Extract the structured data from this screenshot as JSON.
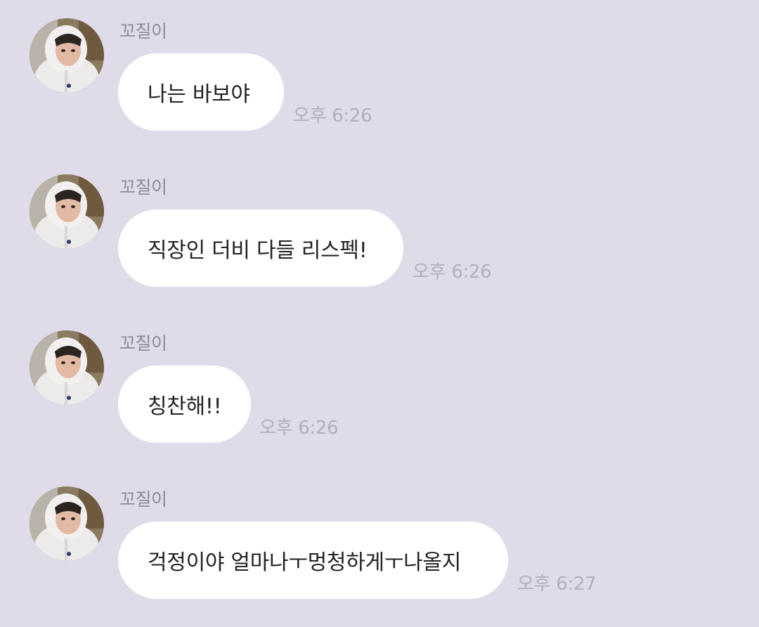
{
  "chat": {
    "messages": [
      {
        "sender": "꼬질이",
        "text": "나는 바보야",
        "time": "오후 6:26",
        "avatar_icon": "profile-photo"
      },
      {
        "sender": "꼬질이",
        "text": "직장인 더비 다들 리스펙!",
        "time": "오후 6:26",
        "avatar_icon": "profile-photo"
      },
      {
        "sender": "꼬질이",
        "text": "칭찬해!!",
        "time": "오후 6:26",
        "avatar_icon": "profile-photo"
      },
      {
        "sender": "꼬질이",
        "text": "걱정이야 얼마나ㅜ멍청하게ㅜ나올지",
        "time": "오후 6:27",
        "avatar_icon": "profile-photo"
      }
    ]
  },
  "colors": {
    "background": "#dfdbe8",
    "bubble": "#ffffff",
    "sender_text": "#8e8a96",
    "time_text": "#b3aebd",
    "message_text": "#222222"
  }
}
